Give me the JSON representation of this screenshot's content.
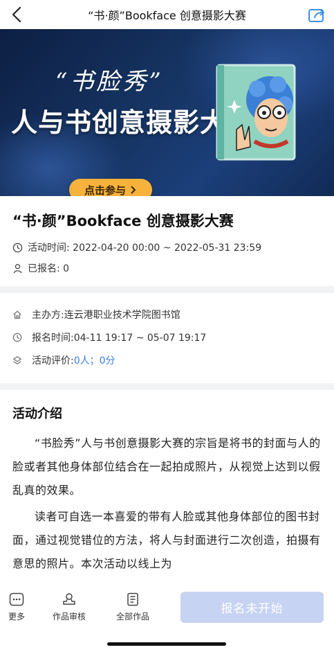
{
  "nav": {
    "title": "“书·颜”Bookface 创意摄影大赛",
    "back_icon": "chevron-left-icon",
    "share_icon": "share-icon"
  },
  "banner": {
    "slogan": "“书脸秀”",
    "headline": "人与书创意摄影大赛",
    "join_label": "点击参与",
    "accent": "#f6b23a"
  },
  "activity": {
    "title": "“书·颜”Bookface 创意摄影大赛",
    "time_label": "活动时间: 2022-04-20 00:00 ~ 2022-05-31 23:59",
    "signed_label": "已报名: 0"
  },
  "details": {
    "organizer": "主办方:连云港职业技术学院图书馆",
    "signup_time": "报名时间:04-11 19:17 ~ 05-07 19:17",
    "rating_prefix": "活动评价:",
    "rating_value": "0人；0分",
    "link_color": "#3a7be0"
  },
  "intro": {
    "heading": "活动介绍",
    "paragraphs": [
      "“书脸秀”人与书创意摄影大赛的宗旨是将书的封面与人的脸或者其他身体部位结合在一起拍成照片，从视觉上达到以假乱真的效果。",
      "读者可自选一本喜爱的带有人脸或其他身体部位的图书封面，通过视觉错位的方法，将人与封面进行二次创造，拍摄有意思的照片。本次活动以线上为"
    ]
  },
  "bottom": {
    "more": "更多",
    "review": "作品审核",
    "all_works": "全部作品",
    "signup_button": "报名未开始",
    "button_color": "#c7d3f2"
  }
}
